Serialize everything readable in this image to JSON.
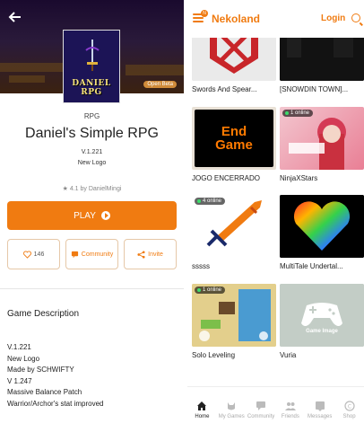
{
  "game": {
    "logo_text": "DANIEL RPG",
    "tag": "Open Beta",
    "genre": "RPG",
    "title": "Daniel's Simple RPG",
    "version": "V.1.221",
    "subtitle": "New Logo",
    "rating": "★ 4.1  by DanielMingi",
    "play_label": "PLAY",
    "like_count": "146",
    "community_label": "Community",
    "invite_label": "Invite"
  },
  "description": {
    "heading": "Game Description",
    "lines": [
      "V.1.221",
      "New Logo",
      "Made by SCHWIFTY",
      "V 1.247",
      "Massive Balance Patch",
      "Warrior/Archor's stat improved"
    ]
  },
  "header": {
    "brand": "Nekoland",
    "badge": "N",
    "login": "Login"
  },
  "games": [
    {
      "title": "Swords And Spear...",
      "online": ""
    },
    {
      "title": "[SNOWDIN TOWN]...",
      "online": ""
    },
    {
      "title": "JOGO ENCERRADO",
      "online": ""
    },
    {
      "title": "NinjaXStars",
      "online": "1 online"
    },
    {
      "title": "sssss",
      "online": "4 online"
    },
    {
      "title": "MultiTale Undertal...",
      "online": ""
    },
    {
      "title": "Solo Leveling",
      "online": "1 online"
    },
    {
      "title": "Vuria",
      "online": ""
    }
  ],
  "thumb_text": {
    "end_game": "End Game",
    "game_image": "Game Image"
  },
  "nav": [
    "Home",
    "My Games",
    "Community",
    "Friends",
    "Messages",
    "Shop"
  ],
  "colors": {
    "accent": "#f07b11"
  }
}
